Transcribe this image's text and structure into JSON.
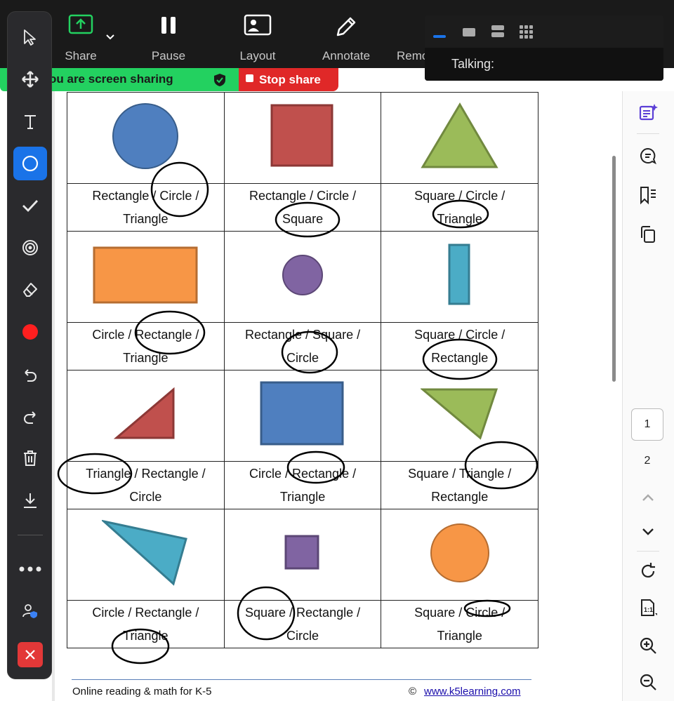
{
  "toolbar": {
    "share": "Share",
    "pause": "Pause",
    "layout": "Layout",
    "annotate": "Annotate",
    "remote": "Remo"
  },
  "share_bar": {
    "text": "ou are screen sharing",
    "stop": "Stop share"
  },
  "popup": {
    "talking": "Talking:"
  },
  "worksheet": {
    "rows": [
      [
        {
          "shape": "circle",
          "color": "#4f7fbf",
          "line1": "Rectangle / Circle /",
          "line2": "Triangle"
        },
        {
          "shape": "square",
          "color": "#c0504d",
          "line1": "Rectangle / Circle /",
          "line2": "Square"
        },
        {
          "shape": "triangle",
          "color": "#9bbb59",
          "line1": "Square / Circle /",
          "line2": "Triangle"
        }
      ],
      [
        {
          "shape": "rectangle",
          "color": "#f79646",
          "line1": "Circle / Rectangle /",
          "line2": "Triangle"
        },
        {
          "shape": "circle",
          "color": "#8064a2",
          "line1": "Rectangle / Square /",
          "line2": "Circle"
        },
        {
          "shape": "rectangle",
          "color": "#4bacc6",
          "line1": "Square / Circle /",
          "line2": "Rectangle"
        }
      ],
      [
        {
          "shape": "triangle",
          "color": "#c0504d",
          "line1": "Triangle / Rectangle /",
          "line2": "Circle"
        },
        {
          "shape": "rectangle",
          "color": "#4f7fbf",
          "line1": "Circle / Rectangle /",
          "line2": "Triangle"
        },
        {
          "shape": "triangle",
          "color": "#9bbb59",
          "line1": "Square / Triangle /",
          "line2": "Rectangle"
        }
      ],
      [
        {
          "shape": "triangle",
          "color": "#4bacc6",
          "line1": "Circle / Rectangle /",
          "line2": "Triangle"
        },
        {
          "shape": "square",
          "color": "#8064a2",
          "line1": "Square / Rectangle /",
          "line2": "Circle"
        },
        {
          "shape": "circle",
          "color": "#f79646",
          "line1": "Square / Circle /",
          "line2": "Triangle"
        }
      ]
    ]
  },
  "footer": {
    "left": "Online reading & math for K-5",
    "copyright": "©",
    "link": "www.k5learning.com"
  },
  "pages": {
    "current": "1",
    "next": "2"
  },
  "colors": {
    "accent": "#1a73e8",
    "share_green": "#23d160",
    "stop_red": "#e02828",
    "annotation_ink": "#000000"
  }
}
